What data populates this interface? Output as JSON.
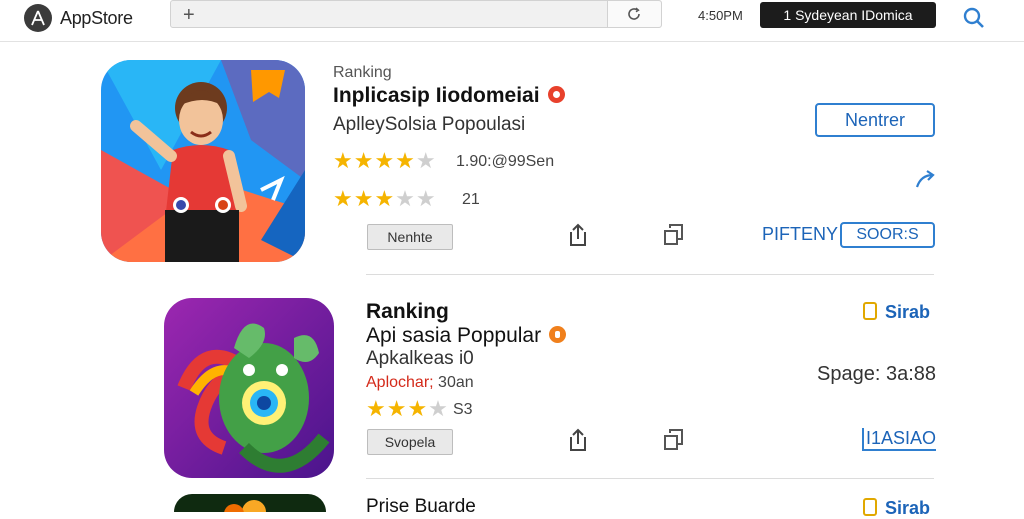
{
  "header": {
    "brand": "AppStore",
    "status": "4:50PM",
    "account_label": "1 Sydeyean IDomica"
  },
  "rows": [
    {
      "label": "Ranking",
      "title": "Inplicasip Iiodomeiai",
      "subtitle": "AplleySolsia Popoulasi",
      "rating_meta": "1.90:@99Sen",
      "rating_meta2": "21",
      "button": "Nenhte",
      "action_button": "Nentrer",
      "link_a": "PIFTENY",
      "link_b": "SOOR:S"
    },
    {
      "label": "Ranking",
      "title": "Api sasia Poppular",
      "subtitle": "Apkalkeas i0",
      "meta_red": "Aplochar;",
      "meta_rest": " 30an",
      "rating_meta": "S3",
      "button": "Svopela",
      "price": "Sirab",
      "size": "Spage: 3a:88",
      "link": "I1ASIAO"
    },
    {
      "title": "Prise Buarde",
      "price": "Sirab"
    }
  ],
  "colors": {
    "accent": "#1c64b8",
    "star": "#f5b400",
    "badge_red": "#e8412c",
    "badge_orange": "#f0801c"
  }
}
